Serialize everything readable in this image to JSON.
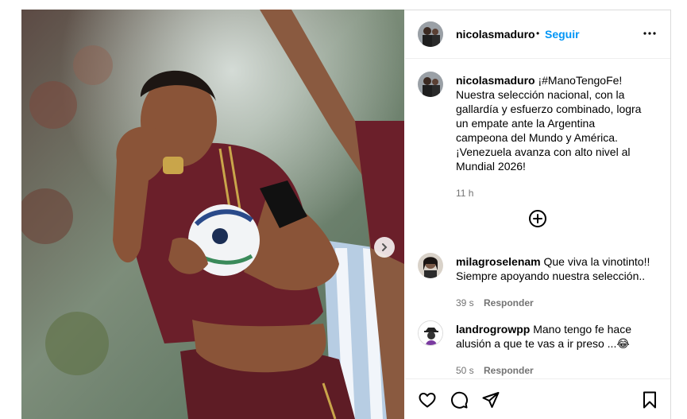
{
  "post": {
    "username": "nicolasmaduro",
    "follow_label": "Seguir",
    "separator": "•",
    "caption_hashtag": "¡#ManoTengoFe!",
    "caption_lines": [
      "Nuestra selección nacional, con la",
      "gallardía y esfuerzo combinado, logra",
      "un empate ante la Argentina",
      "campeona del Mundo y América.",
      "¡Venezuela avanza con alto nivel al",
      "Mundial 2026!"
    ],
    "time": "11 h"
  },
  "comments": [
    {
      "username": "milagroselenam",
      "text_line1": "Que viva la vinotinto!!",
      "text_line2": "Siempre apoyando nuestra selección..",
      "time": "39 s",
      "reply_label": "Responder"
    },
    {
      "username": "landrogrowpp",
      "text_line1": "Mano tengo fe hace",
      "text_line2": "alusión a que te vas a ir preso ...😂",
      "time": "50 s",
      "reply_label": "Responder"
    }
  ],
  "icons": {
    "more": "more-options-icon",
    "load_more": "plus-circle-icon",
    "like": "heart-icon",
    "comment": "comment-icon",
    "share": "share-icon",
    "save": "bookmark-icon",
    "next": "chevron-right-icon"
  },
  "colors": {
    "link_blue": "#0095f6",
    "muted_text": "#737373",
    "border": "#dbdbdb",
    "jersey": "#6b1f2a"
  }
}
